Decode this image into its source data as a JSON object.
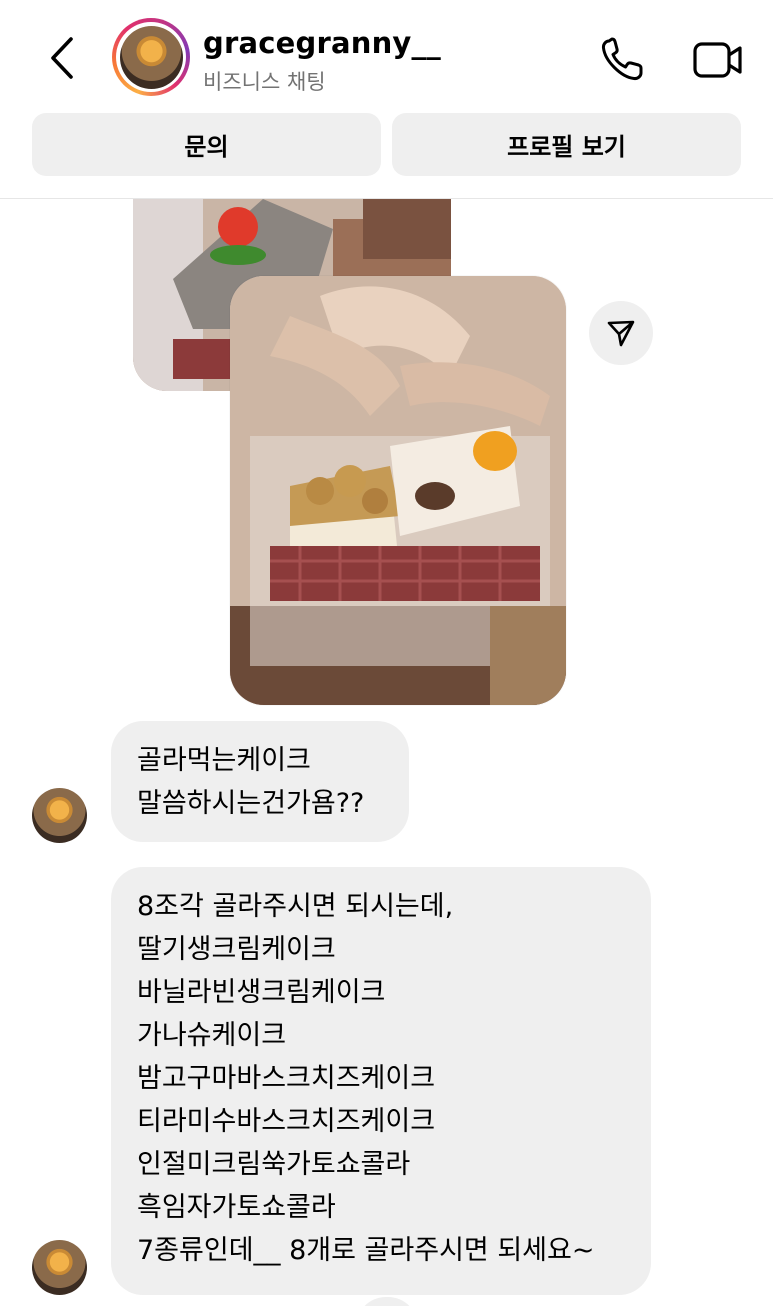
{
  "header": {
    "username": "gracegranny__",
    "subtitle": "비즈니스 채팅",
    "icons": {
      "back": "chevron-left-icon",
      "call": "phone-icon",
      "video": "video-camera-icon"
    }
  },
  "actions": {
    "inquiry_label": "문의",
    "profile_label": "프로필 보기"
  },
  "messages": [
    {
      "type": "photo",
      "description_icon": "image-icon"
    },
    {
      "type": "text",
      "lines": [
        "골라먹는케이크",
        "말씀하시는건가욤??"
      ]
    },
    {
      "type": "text",
      "lines": [
        "8조각 골라주시면 되시는데,",
        "딸기생크림케이크",
        "바닐라빈생크림케이크",
        "가나슈케이크",
        "밤고구마바스크치즈케이크",
        "티라미수바스크치즈케이크",
        "인절미크림쑥가토쇼콜라",
        "흑임자가토쇼콜라",
        "7종류인데__ 8개로 골라주시면 되세요~"
      ]
    }
  ],
  "colors": {
    "bubble": "#efefef",
    "secondary_text": "#737373",
    "ring_gradient": [
      "#fcaf45",
      "#e1306c",
      "#833ab4"
    ]
  }
}
